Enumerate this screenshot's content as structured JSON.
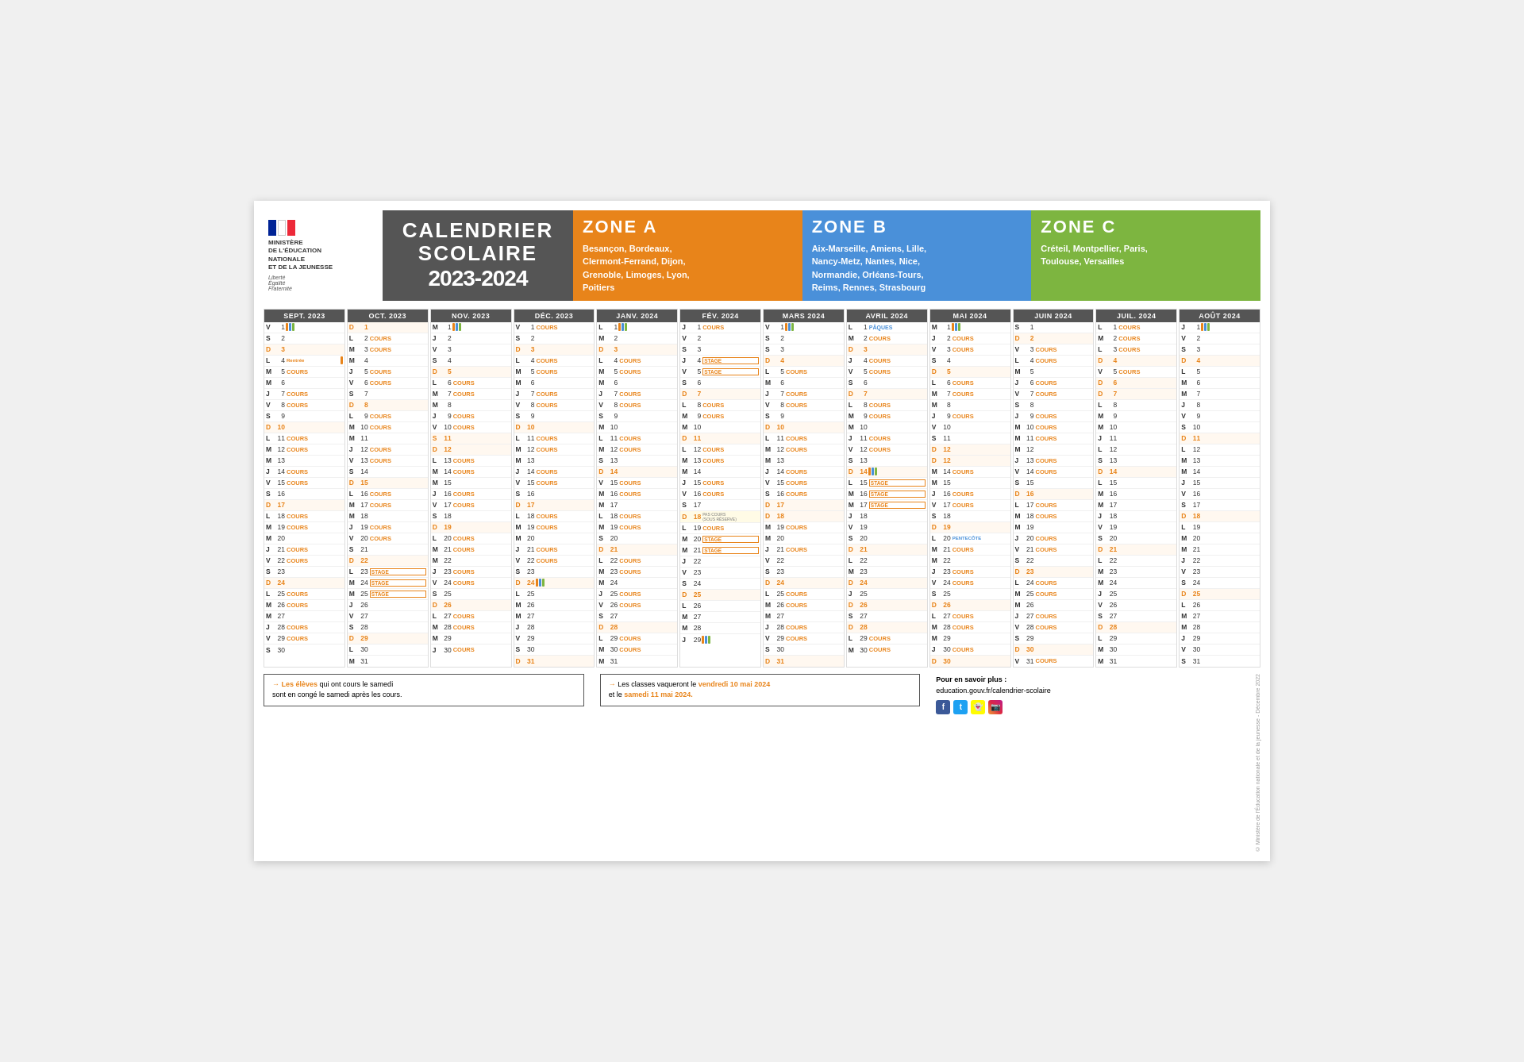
{
  "header": {
    "title_line1": "CALENDRIER",
    "title_line2": "SCOLAIRE",
    "year": "2023-2024",
    "ministry": "MINISTÈRE\nDE L'ÉDUCATION\nNATIONALE\nET DE LA JEUNESSE",
    "motto": "Liberté\nÉgalité\nFraternité"
  },
  "zones": {
    "a": {
      "label": "ZONE A",
      "cities": "Besançon, Bordeaux,\nClermont-Ferrand, Dijon,\nGrenoble, Limoges, Lyon,\nPoitiers"
    },
    "b": {
      "label": "ZONE B",
      "cities": "Aix-Marseille, Amiens, Lille,\nNancy-Metz, Nantes, Nice,\nNormandie, Orléans-Tours,\nReims, Rennes, Strasbourg"
    },
    "c": {
      "label": "ZONE C",
      "cities": "Créteil, Montpellier, Paris,\nToulouse, Versailles"
    }
  },
  "footer": {
    "note1": "→ Les élèves qui ont cours le samedi\nsont en congé le samedi après les cours.",
    "note2": "→ Les classes vaqueront le vendredi 10 mai 2024\net le samedi 11 mai 2024.",
    "info": "Pour en savoir plus :\neducation.gouv.fr/calendrier-scolaire",
    "copyright": "© Ministère de l'Éducation nationale et de la jeunesse - Décembre 2022"
  }
}
